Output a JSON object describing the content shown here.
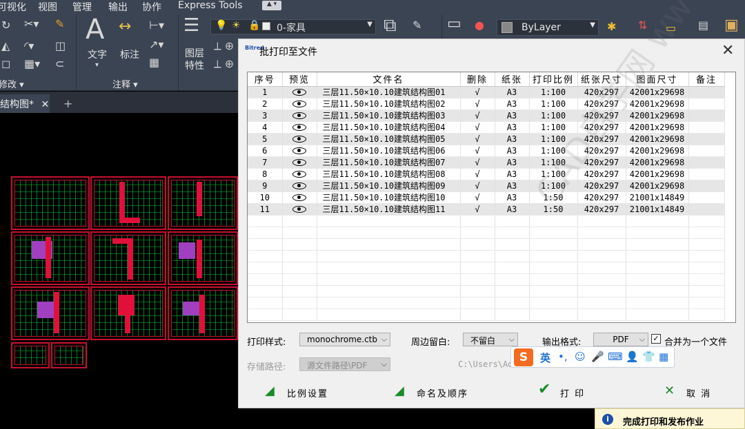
{
  "menubar": {
    "items": [
      "可视化",
      "视图",
      "管理",
      "输出",
      "协作",
      "Express Tools"
    ]
  },
  "ribbon": {
    "text_label": "文字",
    "dim_label": "标注",
    "layer_props_label": "图层\n特性",
    "layer_current": "0-家具",
    "color_current": "ByLayer",
    "panel_modify": "修改",
    "panel_annotate": "注释"
  },
  "doc_tab": {
    "label": "结构图*",
    "close": "✕",
    "new_tab": "+"
  },
  "dialog": {
    "title": "批打印至文件",
    "logo": "Bitred",
    "close": "✕",
    "columns": [
      "序号",
      "预览",
      "文件名",
      "删除",
      "纸张",
      "打印比例",
      "纸张尺寸",
      "图面尺寸",
      "备注"
    ],
    "rows": [
      {
        "no": "1",
        "name": "三层11.50×10.10建筑结构图01",
        "del": "√",
        "paper": "A3",
        "scale": "1:100",
        "paper_size": "420x297",
        "drawing_size": "42001x29698",
        "note": ""
      },
      {
        "no": "2",
        "name": "三层11.50×10.10建筑结构图02",
        "del": "√",
        "paper": "A3",
        "scale": "1:100",
        "paper_size": "420x297",
        "drawing_size": "42001x29698",
        "note": ""
      },
      {
        "no": "3",
        "name": "三层11.50×10.10建筑结构图03",
        "del": "√",
        "paper": "A3",
        "scale": "1:100",
        "paper_size": "420x297",
        "drawing_size": "42001x29698",
        "note": ""
      },
      {
        "no": "4",
        "name": "三层11.50×10.10建筑结构图04",
        "del": "√",
        "paper": "A3",
        "scale": "1:100",
        "paper_size": "420x297",
        "drawing_size": "42001x29698",
        "note": ""
      },
      {
        "no": "5",
        "name": "三层11.50×10.10建筑结构图05",
        "del": "√",
        "paper": "A3",
        "scale": "1:100",
        "paper_size": "420x297",
        "drawing_size": "42001x29698",
        "note": ""
      },
      {
        "no": "6",
        "name": "三层11.50×10.10建筑结构图06",
        "del": "√",
        "paper": "A3",
        "scale": "1:100",
        "paper_size": "420x297",
        "drawing_size": "42001x29698",
        "note": ""
      },
      {
        "no": "7",
        "name": "三层11.50×10.10建筑结构图07",
        "del": "√",
        "paper": "A3",
        "scale": "1:100",
        "paper_size": "420x297",
        "drawing_size": "42001x29698",
        "note": ""
      },
      {
        "no": "8",
        "name": "三层11.50×10.10建筑结构图08",
        "del": "√",
        "paper": "A3",
        "scale": "1:100",
        "paper_size": "420x297",
        "drawing_size": "42001x29698",
        "note": ""
      },
      {
        "no": "9",
        "name": "三层11.50×10.10建筑结构图09",
        "del": "√",
        "paper": "A3",
        "scale": "1:100",
        "paper_size": "420x297",
        "drawing_size": "42001x29698",
        "note": ""
      },
      {
        "no": "10",
        "name": "三层11.50×10.10建筑结构图10",
        "del": "√",
        "paper": "A3",
        "scale": "1:50",
        "paper_size": "420x297",
        "drawing_size": "21001x14849",
        "note": ""
      },
      {
        "no": "11",
        "name": "三层11.50×10.10建筑结构图11",
        "del": "√",
        "paper": "A3",
        "scale": "1:50",
        "paper_size": "420x297",
        "drawing_size": "21001x14849",
        "note": ""
      }
    ],
    "print_style_label": "打印样式:",
    "print_style_value": "monochrome.ctb",
    "margin_label": "周边留白:",
    "margin_value": "不留白",
    "format_label": "输出格式:",
    "format_value": "PDF",
    "merge_label": "合并为一个文件",
    "merge_checked": "✓",
    "path_label": "存储路径:",
    "path_value": "源文件路径\\PDF",
    "path_text": "C:\\Users\\Adm",
    "btn_scale": "比例设置",
    "btn_naming": "命名及顺序",
    "btn_print": "打 印",
    "btn_cancel": "取 消",
    "watermark": "CAD自学网 www.cadzxw.com"
  },
  "ime": {
    "logo": "S",
    "lang": "英",
    "items": [
      "•,",
      "☺",
      "🎤",
      "⌨",
      "👤",
      "👕",
      "▦"
    ]
  },
  "notification": {
    "text": "完成打印和发布作业",
    "icon": "i"
  }
}
